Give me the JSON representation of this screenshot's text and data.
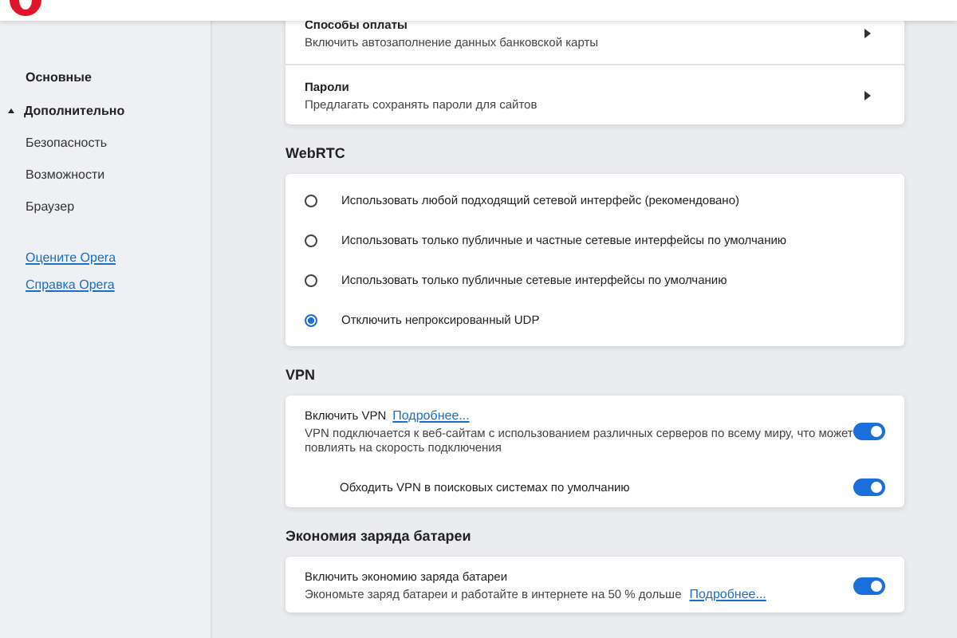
{
  "sidebar": {
    "items": [
      {
        "label": "Основные",
        "kind": "section",
        "expanded": false
      },
      {
        "label": "Дополнительно",
        "kind": "section",
        "expanded": true
      },
      {
        "label": "Безопасность",
        "kind": "sub"
      },
      {
        "label": "Возможности",
        "kind": "sub"
      },
      {
        "label": "Браузер",
        "kind": "sub"
      }
    ],
    "links": [
      "Оцените Opera",
      "Справка Opera"
    ]
  },
  "top_card": {
    "rows": [
      {
        "title": "Способы оплаты",
        "description": "Включить автозаполнение данных банковской карты"
      },
      {
        "title": "Пароли",
        "description": "Предлагать сохранять пароли для сайтов"
      }
    ]
  },
  "webrtc": {
    "heading": "WebRTC",
    "options": [
      {
        "label": "Использовать любой подходящий сетевой интерфейс (рекомендовано)",
        "selected": false
      },
      {
        "label": "Использовать только публичные и частные сетевые интерфейсы по умолчанию",
        "selected": false
      },
      {
        "label": "Использовать только публичные сетевые интерфейсы по умолчанию",
        "selected": false
      },
      {
        "label": "Отключить непроксированный UDP",
        "selected": true
      }
    ]
  },
  "vpn": {
    "heading": "VPN",
    "rows": [
      {
        "kind": "main",
        "title": "Включить VPN",
        "link": "Подробнее...",
        "description": "VPN подключается к веб-сайтам с использованием различных серверов по всему миру, что может повлиять на скорость подключения",
        "on": true
      },
      {
        "kind": "sub",
        "title": "Обходить VPN в поисковых системах по умолчанию",
        "on": true
      }
    ]
  },
  "battery": {
    "heading": "Экономия заряда батареи",
    "rows": [
      {
        "kind": "main",
        "title": "Включить экономию заряда батареи",
        "description": "Экономьте заряд батареи и работайте в интернете на 50 % дольше",
        "link": "Подробнее...",
        "on": true
      }
    ]
  }
}
